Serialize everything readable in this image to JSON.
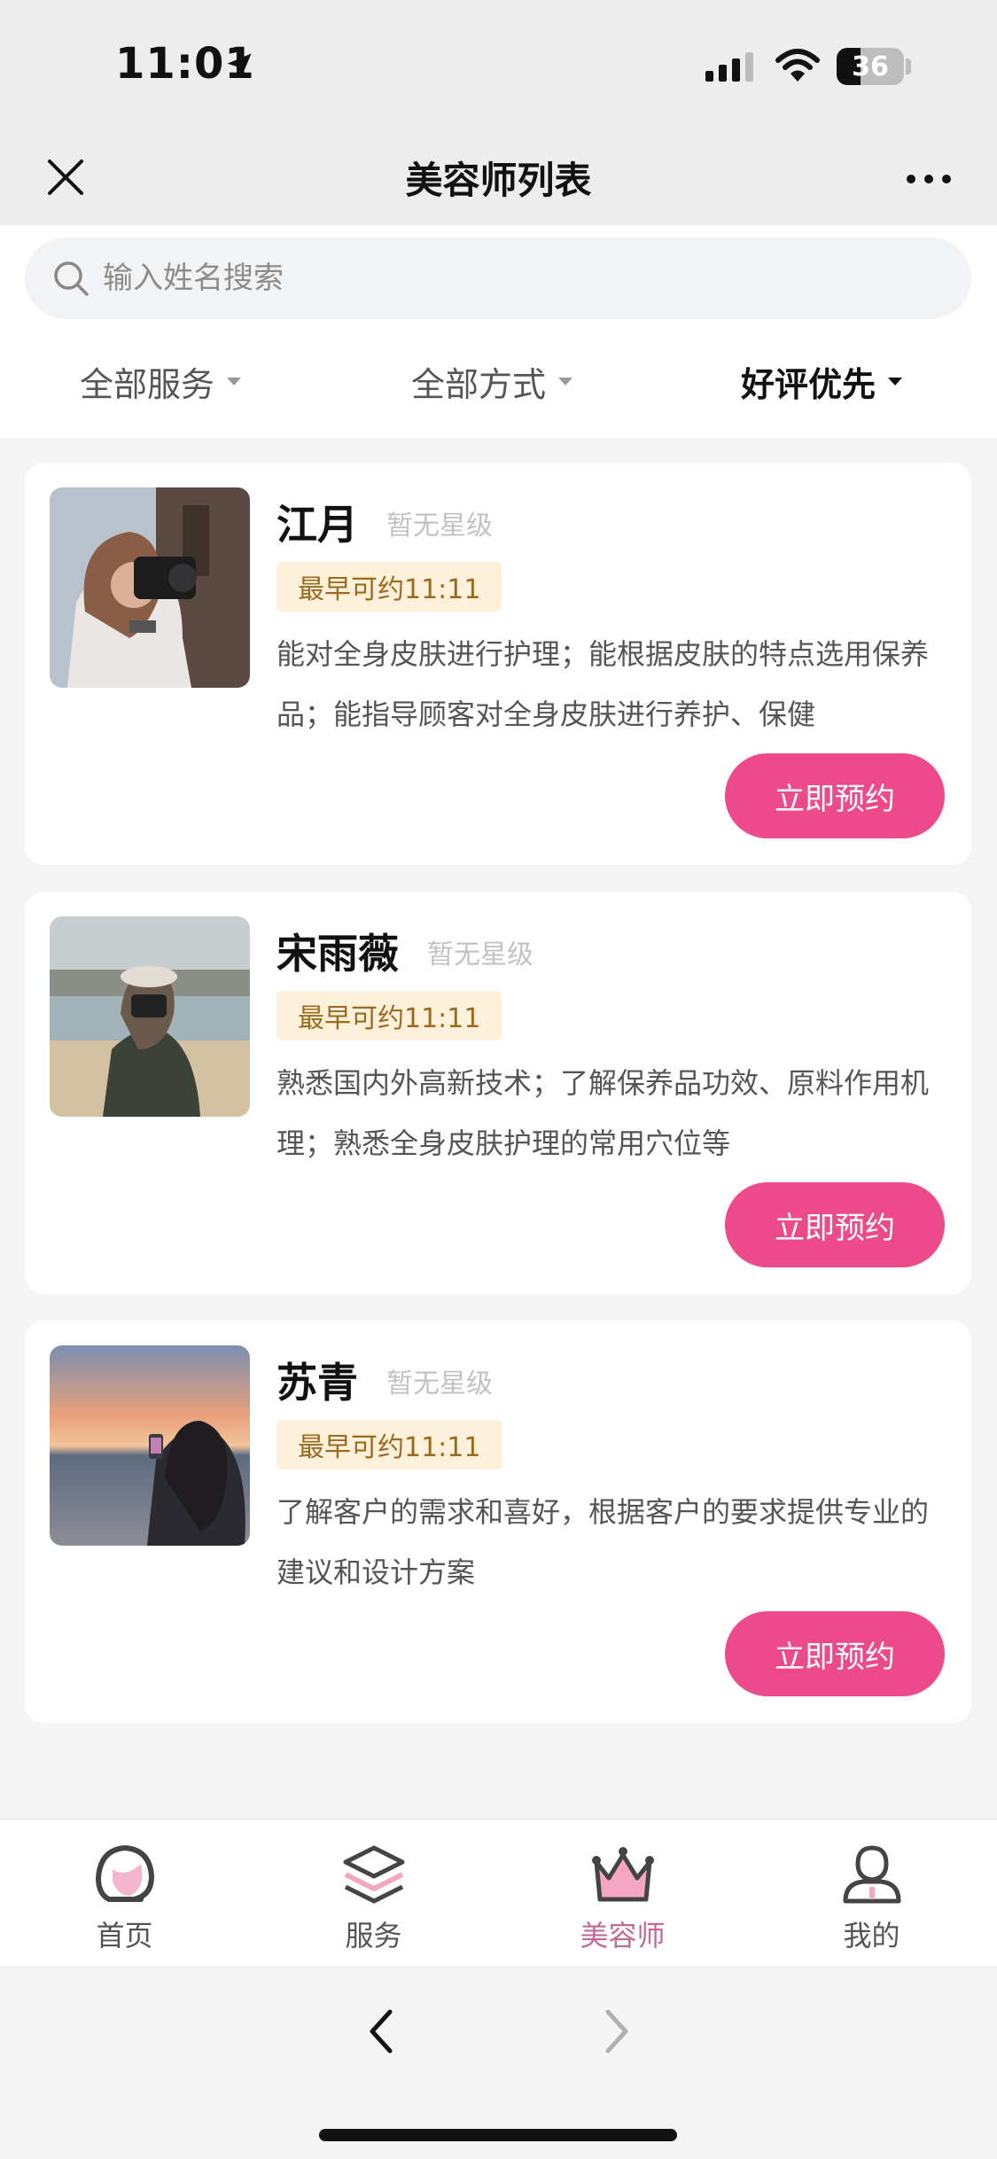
{
  "status_bar": {
    "time": "11:01",
    "battery": "36",
    "battery_level": 0.36
  },
  "nav": {
    "title": "美容师列表"
  },
  "search": {
    "placeholder": "输入姓名搜索"
  },
  "filters": [
    {
      "label": "全部服务",
      "active": false
    },
    {
      "label": "全部方式",
      "active": false
    },
    {
      "label": "好评优先",
      "active": true
    }
  ],
  "beauticians": [
    {
      "name": "江月",
      "rating": "暂无星级",
      "availability": "最早可约11:11",
      "description": "能对全身皮肤进行护理；能根据皮肤的特点选用保养品；能指导顾客对全身皮肤进行养护、保健",
      "book_label": "立即预约"
    },
    {
      "name": "宋雨薇",
      "rating": "暂无星级",
      "availability": "最早可约11:11",
      "description": "熟悉国内外高新技术；了解保养品功效、原料作用机理；熟悉全身皮肤护理的常用穴位等",
      "book_label": "立即预约"
    },
    {
      "name": "苏青",
      "rating": "暂无星级",
      "availability": "最早可约11:11",
      "description": "了解客户的需求和喜好，根据客户的要求提供专业的建议和设计方案",
      "book_label": "立即预约"
    }
  ],
  "tabs": [
    {
      "label": "首页",
      "icon": "home-face-icon",
      "active": false
    },
    {
      "label": "服务",
      "icon": "layers-icon",
      "active": false
    },
    {
      "label": "美容师",
      "icon": "crown-icon",
      "active": true
    },
    {
      "label": "我的",
      "icon": "user-icon",
      "active": false
    }
  ],
  "colors": {
    "accent": "#ec4a8a",
    "badge_bg": "#fdf1db",
    "badge_text": "#9a6b1f",
    "active_tab": "#c26a96"
  }
}
